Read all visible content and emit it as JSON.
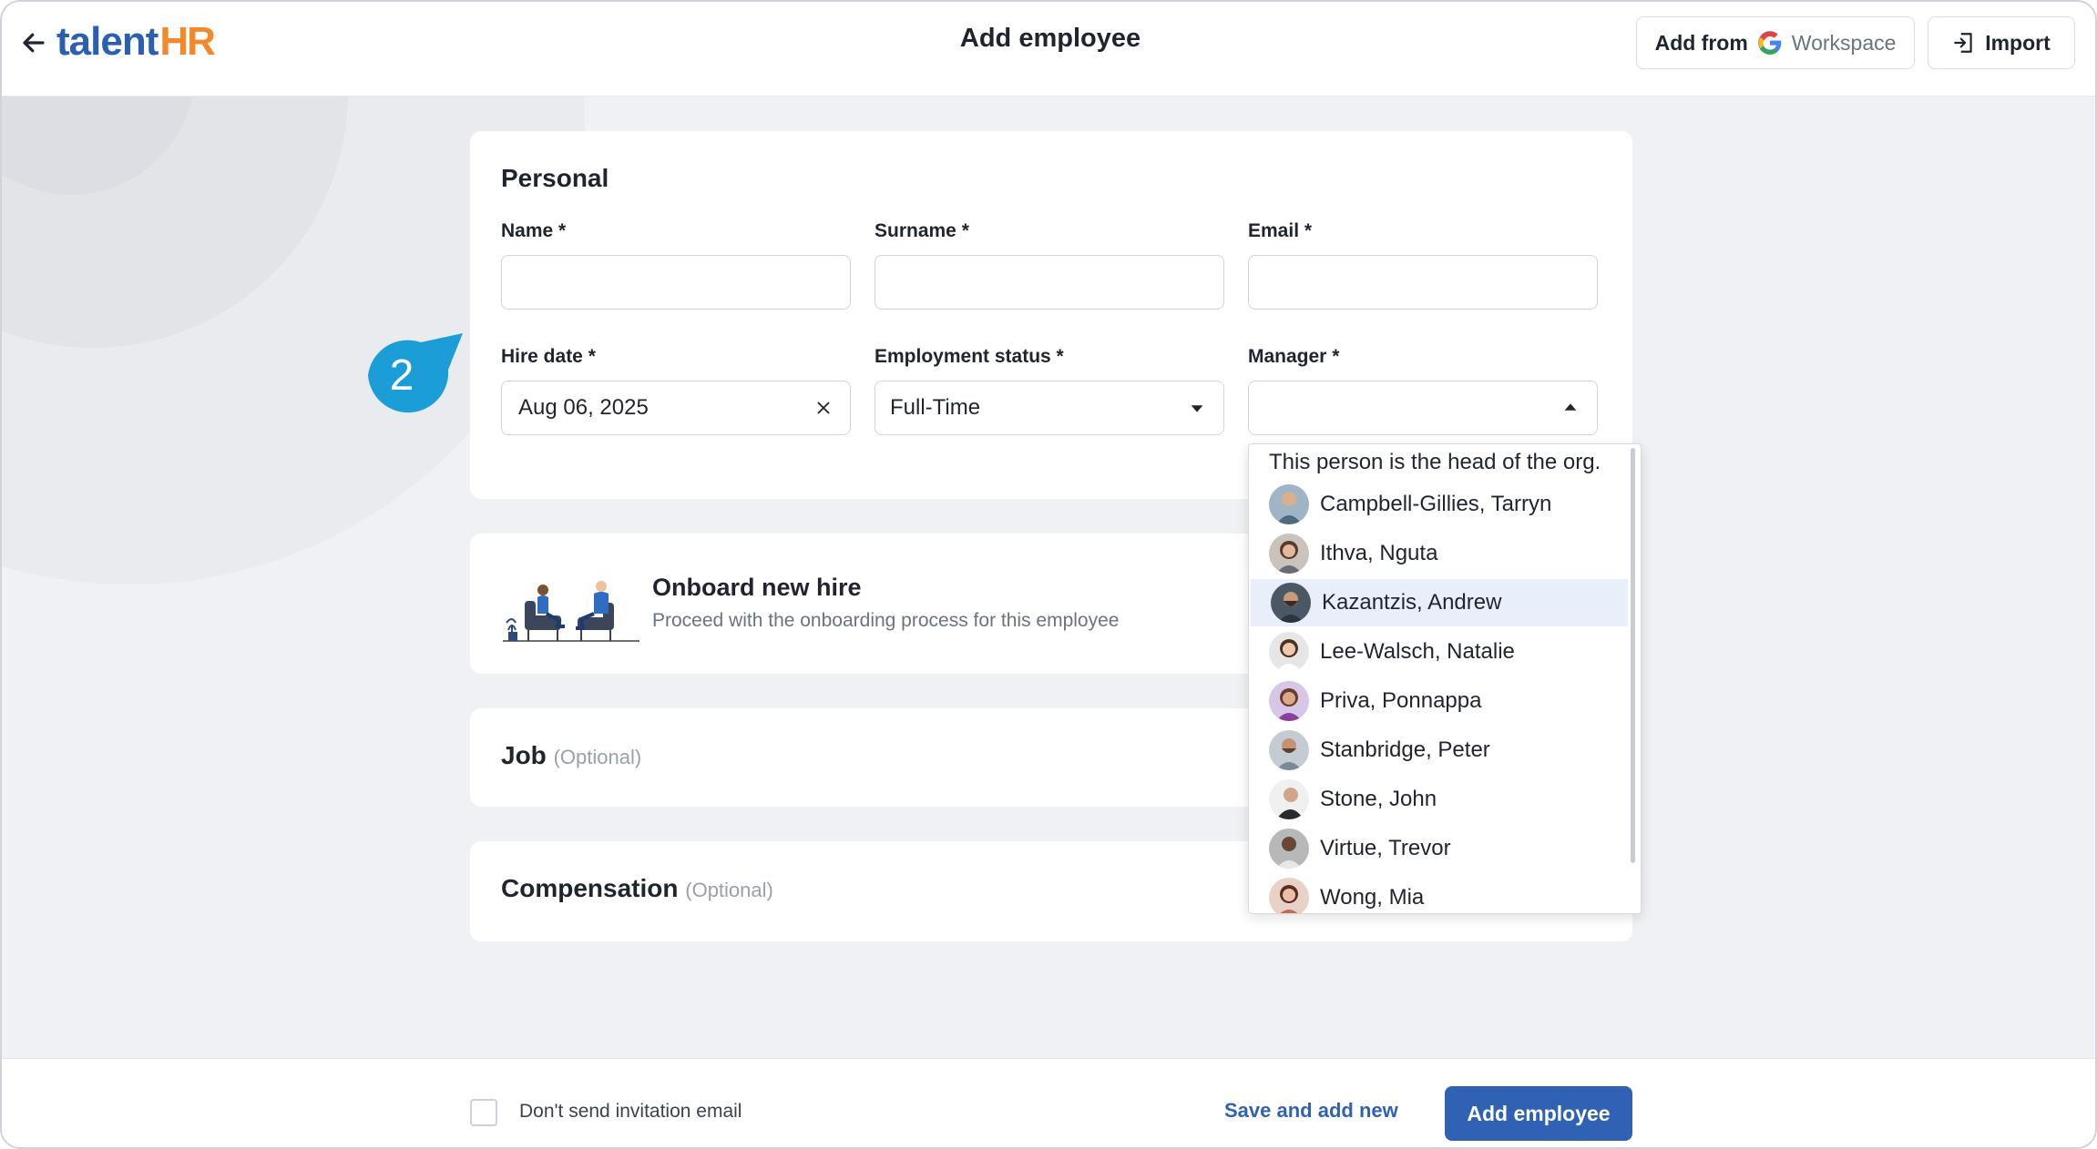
{
  "header": {
    "logo_text": "talent",
    "logo_accent": "HR",
    "title": "Add employee",
    "add_from_label": "Add from",
    "workspace_label": "Workspace",
    "import_label": "Import"
  },
  "personal": {
    "title": "Personal",
    "name_label": "Name *",
    "surname_label": "Surname *",
    "email_label": "Email *",
    "hire_date_label": "Hire date *",
    "hire_date_value": "Aug 06, 2025",
    "employment_status_label": "Employment status *",
    "employment_status_value": "Full-Time",
    "manager_label": "Manager *",
    "manager_value": ""
  },
  "step_callout": "2",
  "onboard": {
    "title": "Onboard new hire",
    "subtitle": "Proceed with the onboarding process for this employee"
  },
  "job": {
    "title": "Job",
    "optional": "(Optional)"
  },
  "compensation": {
    "title": "Compensation",
    "optional": "(Optional)"
  },
  "manager_dropdown": {
    "header": "This person is the head of the org.",
    "items": [
      {
        "name": "Campbell-Gillies, Tarryn"
      },
      {
        "name": "Ithva, Nguta"
      },
      {
        "name": "Kazantzis, Andrew"
      },
      {
        "name": "Lee-Walsch, Natalie"
      },
      {
        "name": "Priva, Ponnappa"
      },
      {
        "name": "Stanbridge, Peter"
      },
      {
        "name": "Stone, John"
      },
      {
        "name": "Virtue, Trevor"
      },
      {
        "name": "Wong, Mia"
      }
    ],
    "highlighted": "Kazantzis, Andrew"
  },
  "footer": {
    "dont_send_label": "Don't send invitation email",
    "save_and_add_new": "Save and add new",
    "add_employee": "Add employee"
  },
  "colors": {
    "primary": "#2f62b3",
    "logo_blue": "#2b5fb0",
    "logo_orange": "#f08a2c",
    "callout": "#1b9ed8",
    "highlight_row": "#e8effb"
  }
}
